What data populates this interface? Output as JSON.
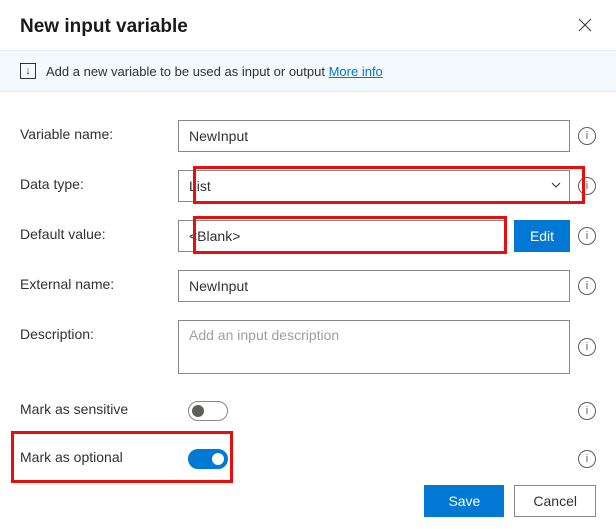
{
  "dialog": {
    "title": "New input variable",
    "close_aria": "Close"
  },
  "info": {
    "text": "Add a new variable to be used as input or output ",
    "link": "More info"
  },
  "labels": {
    "variable_name": "Variable name:",
    "data_type": "Data type:",
    "default_value": "Default value:",
    "external_name": "External name:",
    "description": "Description:",
    "mark_sensitive": "Mark as sensitive",
    "mark_optional": "Mark as optional"
  },
  "fields": {
    "variable_name": "NewInput",
    "data_type": "List",
    "default_value": "<Blank>",
    "external_name": "NewInput",
    "description_placeholder": "Add an input description"
  },
  "buttons": {
    "edit": "Edit",
    "save": "Save",
    "cancel": "Cancel"
  },
  "toggles": {
    "mark_sensitive": false,
    "mark_optional": true
  },
  "icons": {
    "help": "i",
    "download": "↓"
  },
  "highlights": [
    "data-type-row",
    "default-value-row",
    "mark-optional-row"
  ]
}
